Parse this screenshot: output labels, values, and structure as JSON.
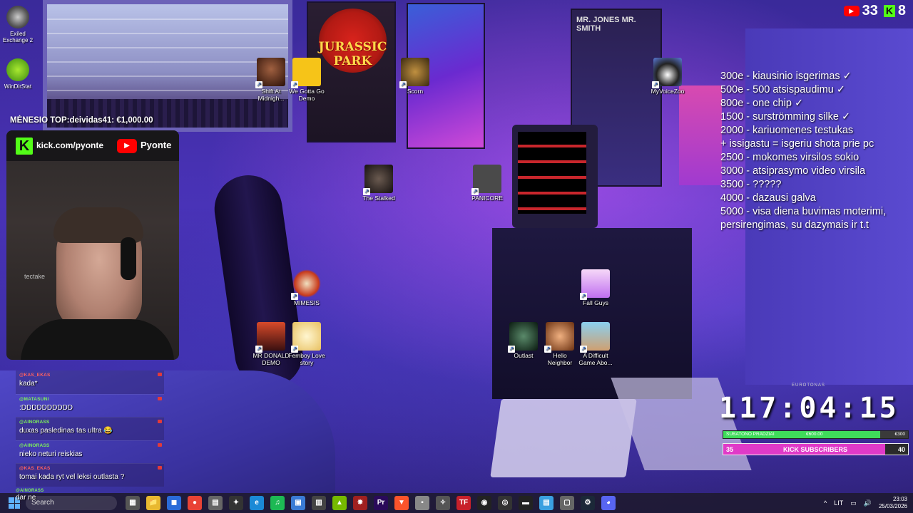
{
  "desktop_icons": [
    {
      "id": "exiled",
      "label": "Exiled Exchange 2"
    },
    {
      "id": "windirstat",
      "label": "WinDirStat"
    },
    {
      "id": "shift",
      "label": "Shift At Midnigh..."
    },
    {
      "id": "wegotta",
      "label": "We Gotta Go Demo"
    },
    {
      "id": "scorn",
      "label": "Scorn"
    },
    {
      "id": "myvoicezoo",
      "label": "MyVoiceZoo"
    },
    {
      "id": "stalked",
      "label": "The Stalked"
    },
    {
      "id": "panicore",
      "label": "PANICORE"
    },
    {
      "id": "mimesis",
      "label": "MIMESIS"
    },
    {
      "id": "fallguys",
      "label": "Fall Guys"
    },
    {
      "id": "mrdonald",
      "label": "MR DONALD DEMO"
    },
    {
      "id": "femboy",
      "label": "Femboy Love story"
    },
    {
      "id": "outlast",
      "label": "Outlast"
    },
    {
      "id": "hello",
      "label": "Hello Neighbor"
    },
    {
      "id": "difficult",
      "label": "A Difficult Game Abo..."
    }
  ],
  "posters": {
    "jurassic_title": "JURASSIC PARK",
    "mib_title": "MR. JONES  MR. SMITH"
  },
  "overlay": {
    "top_donor": "MĖNESIO TOP:deividas41: €1,000.00",
    "kick_url": "kick.com/pyonte",
    "yt_name": "Pyonte",
    "chair_brand": "tectake",
    "counters": {
      "youtube": "33",
      "kick": "8",
      "youtube_icon": "▶",
      "kick_icon": "K"
    },
    "goals": [
      "300e - kiausinio isgerimas ✓",
      "500e - 500 atsispaudimu ✓",
      "800e - one chip ✓",
      "1500 - surströmming silke ✓",
      "2000 - kariuomenes testukas",
      "+ issigastu = isgeriu shota prie pc",
      "2500 - mokomes virsilos sokio",
      "3000 - atsiprasymo video virsila",
      "3500 - ?????",
      "4000 - dazausi galva",
      "5000 - visa diena buvimas moterimi,",
      "persirengimas, su dazymais ir t.t"
    ],
    "timer": "117:04:15",
    "subathon": {
      "label": "SUBATONO PRADZIAI",
      "current": "€600.00",
      "target": "€300",
      "progress": 0.85,
      "header": "EUROTONAS"
    },
    "kick_subs": {
      "left": "35",
      "label": "KICK SUBSCRIBERS",
      "right": "40",
      "progress": 0.875
    }
  },
  "chat": [
    {
      "user": "@KAS_EKAS",
      "text": "kada*",
      "color": "red"
    },
    {
      "user": "@MATASUNI",
      "text": ":DDDDDDDDDD",
      "color": "green"
    },
    {
      "user": "@AINORASS",
      "text": "duxas pasledinas tas ultra 😂",
      "color": "green"
    },
    {
      "user": "@AINORASS",
      "text": "nieko neturi reiskias",
      "color": "green"
    },
    {
      "user": "@KAS_EKAS",
      "text": "tomai kada ryt vel leksi outlasta ?",
      "color": "red"
    },
    {
      "user": "@AINORASS",
      "text": "dar ne",
      "color": "green"
    }
  ],
  "taskbar": {
    "search_placeholder": "Search",
    "lang": "LIT",
    "time": "23:03",
    "date": "25/03/2026",
    "apps": [
      {
        "name": "task-view",
        "glyph": "▦",
        "color": "#555"
      },
      {
        "name": "file-explorer",
        "glyph": "📁",
        "color": "#e8b830"
      },
      {
        "name": "store",
        "glyph": "◼",
        "color": "#2a6bd8"
      },
      {
        "name": "chrome",
        "glyph": "●",
        "color": "#e94335"
      },
      {
        "name": "app-1",
        "glyph": "▤",
        "color": "#666"
      },
      {
        "name": "app-2",
        "glyph": "✦",
        "color": "#333"
      },
      {
        "name": "edge",
        "glyph": "e",
        "color": "#1b8ad6"
      },
      {
        "name": "spotify",
        "glyph": "♫",
        "color": "#1db954"
      },
      {
        "name": "photos",
        "glyph": "▣",
        "color": "#3a7bd5"
      },
      {
        "name": "app-3",
        "glyph": "▥",
        "color": "#444"
      },
      {
        "name": "nvidia",
        "glyph": "▲",
        "color": "#76b900"
      },
      {
        "name": "app-4",
        "glyph": "✸",
        "color": "#a02020"
      },
      {
        "name": "premiere",
        "glyph": "Pr",
        "color": "#2a0a5a"
      },
      {
        "name": "brave",
        "glyph": "▼",
        "color": "#fb542b"
      },
      {
        "name": "app-5",
        "glyph": "▪",
        "color": "#888"
      },
      {
        "name": "app-6",
        "glyph": "✧",
        "color": "#555"
      },
      {
        "name": "tf",
        "glyph": "TF",
        "color": "#c8202a"
      },
      {
        "name": "app-7",
        "glyph": "◉",
        "color": "#222"
      },
      {
        "name": "obs",
        "glyph": "◎",
        "color": "#333"
      },
      {
        "name": "terminal",
        "glyph": "▬",
        "color": "#222"
      },
      {
        "name": "notepad",
        "glyph": "▤",
        "color": "#3aa0e0"
      },
      {
        "name": "app-8",
        "glyph": "▢",
        "color": "#666"
      },
      {
        "name": "steam",
        "glyph": "⚙",
        "color": "#1b2838"
      },
      {
        "name": "discord",
        "glyph": "◕",
        "color": "#5865f2"
      }
    ]
  }
}
